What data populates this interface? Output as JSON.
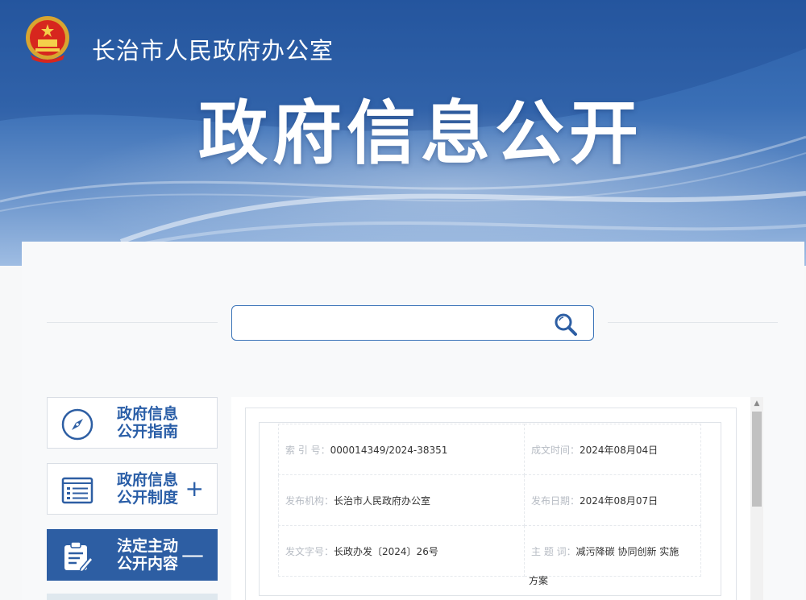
{
  "header": {
    "agency_name": "长治市人民政府办公室",
    "page_title": "政府信息公开"
  },
  "search": {
    "placeholder": "",
    "value": ""
  },
  "menu": [
    {
      "label_line1": "政府信息",
      "label_line2": "公开指南",
      "toggle": "",
      "icon": "compass-icon",
      "active": false
    },
    {
      "label_line1": "政府信息",
      "label_line2": "公开制度",
      "toggle": "+",
      "icon": "list-icon",
      "active": false
    },
    {
      "label_line1": "法定主动",
      "label_line2": "公开内容",
      "toggle": "—",
      "icon": "clipboard-edit-icon",
      "active": true
    }
  ],
  "document_meta": {
    "index_no": {
      "label": "索  引 号：",
      "value": "000014349/2024-38351"
    },
    "written_date": {
      "label": "成文时间：",
      "value": "2024年08月04日"
    },
    "issuer": {
      "label": "发布机构：",
      "value": "长治市人民政府办公室"
    },
    "publish_date": {
      "label": "发布日期：",
      "value": "2024年08月07日"
    },
    "doc_no": {
      "label": "发文字号：",
      "value": "长政办发〔2024〕26号"
    },
    "subject": {
      "label": "主  题  词：",
      "value": "减污降碳 协同创新 实施",
      "value_wrap": "方案"
    }
  },
  "colors": {
    "brand_blue": "#2d5ea3",
    "banner_top": "#2a5ea7",
    "label_gray": "#b7bcc4"
  }
}
